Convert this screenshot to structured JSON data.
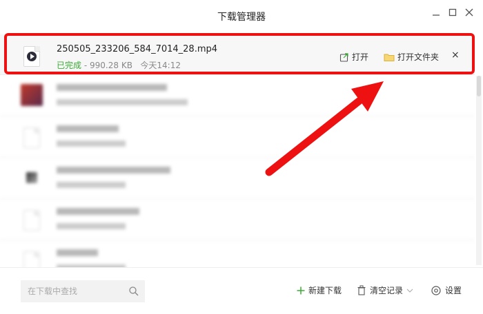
{
  "window": {
    "title": "下载管理器"
  },
  "downloads": [
    {
      "filename": "250505_233206_584_7014_28.mp4",
      "status": "已完成",
      "separator": "-",
      "size": "990.28 KB",
      "time": "今天14:12"
    }
  ],
  "actions": {
    "open": "打开",
    "open_folder": "打开文件夹",
    "close": "×"
  },
  "footer": {
    "search_placeholder": "在下载中查找",
    "new_download": "新建下载",
    "clear_records": "清空记录",
    "settings": "设置"
  },
  "colors": {
    "highlight": "#ee1111",
    "done_status": "#3aaa35",
    "accent_plus": "#3aaa35"
  }
}
